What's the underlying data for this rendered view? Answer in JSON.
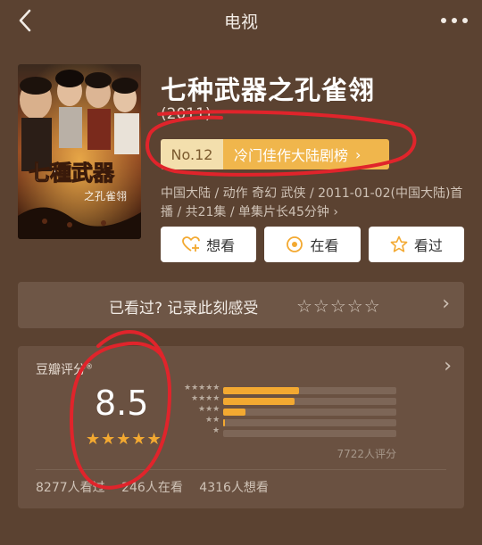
{
  "nav": {
    "title": "电视"
  },
  "movie": {
    "title": "七种武器之孔雀翎",
    "year": "(2011)",
    "rank": {
      "no": "No.12",
      "list": "冷门佳作大陆剧榜"
    },
    "meta": "中国大陆 / 动作 奇幻 武侠 / 2011-01-02(中国大陆)首播 / 共21集 / 单集片长45分钟 ›"
  },
  "actions": [
    {
      "label": "想看",
      "icon": "heart-plus-icon"
    },
    {
      "label": "在看",
      "icon": "eye-circle-icon"
    },
    {
      "label": "看过",
      "icon": "star-outline-icon"
    }
  ],
  "prompt": {
    "text": "已看过? 记录此刻感受",
    "stars": "☆☆☆☆☆"
  },
  "rating": {
    "label": "豆瓣评分",
    "score": "8.5",
    "stars": "★★★★★",
    "raters": "7722人评分",
    "distribution": [
      {
        "stars": "★★★★★",
        "fraction": 0.44
      },
      {
        "stars": "★★★★",
        "fraction": 0.41
      },
      {
        "stars": "★★★",
        "fraction": 0.13
      },
      {
        "stars": "★★",
        "fraction": 0.01
      },
      {
        "stars": "★",
        "fraction": 0.0
      }
    ],
    "stats": {
      "watched": "8277人看过",
      "watching": "246人在看",
      "want": "4316人想看"
    }
  },
  "colors": {
    "background": "#5b4231",
    "accent": "#f3a931",
    "badge": "#f0b64c",
    "annotation": "#e0242b"
  }
}
